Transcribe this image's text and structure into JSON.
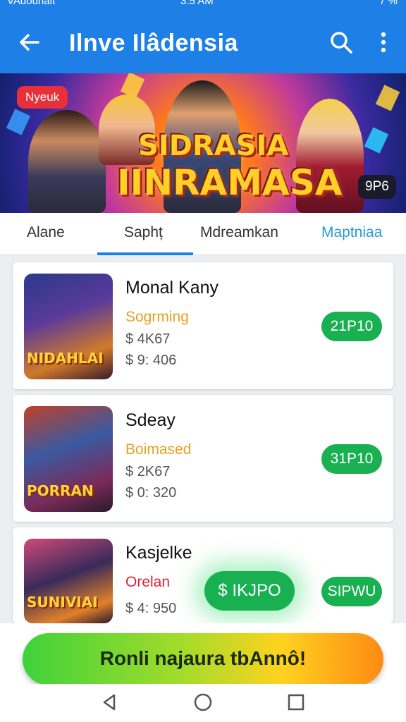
{
  "status_bar": {
    "carrier": "VAdounait",
    "time": "3:5 AM",
    "battery": "7 %"
  },
  "app_bar": {
    "title": "Ilnve Ilâdensia",
    "back_icon": "arrow-left-icon",
    "search_icon": "search-icon",
    "more_icon": "more-vert-icon"
  },
  "banner": {
    "badge": "Nyeuk",
    "title_line1": "SIDRASIA",
    "title_line2": "IINRAMASA",
    "tag": "9P6"
  },
  "tabs": [
    {
      "label": "Alane"
    },
    {
      "label": "Saphț",
      "active": true
    },
    {
      "label": "Mdreamkan"
    },
    {
      "label": "Maptniaa"
    }
  ],
  "cards": [
    {
      "name": "Monal Kany",
      "genre": "Sogrming",
      "line1": "$ 4K67",
      "line2": "$ 9: 406",
      "price": "21P10",
      "thumb_text": "NIDAHLAI"
    },
    {
      "name": "Sdeay",
      "genre": "Boimased",
      "line1": "$ 2K67",
      "line2": "$ 0: 320",
      "price": "31P10",
      "thumb_text": "PORRAN"
    },
    {
      "name": "Kasjelke",
      "genre": "Orelan",
      "line1": "$ 4: 950",
      "line2": "",
      "price": "SIPWU",
      "thumb_text": "SUNIVIAI"
    }
  ],
  "floating_button": {
    "label": "$ IKJPO"
  },
  "cta": {
    "label": "Ronli najaura tbAnnô!"
  },
  "nav": {
    "back": "nav-back-icon",
    "home": "nav-home-icon",
    "recents": "nav-recents-icon"
  },
  "colors": {
    "primary": "#1e80e6",
    "price_green": "#18b050",
    "genre_orange": "#e8a020"
  }
}
